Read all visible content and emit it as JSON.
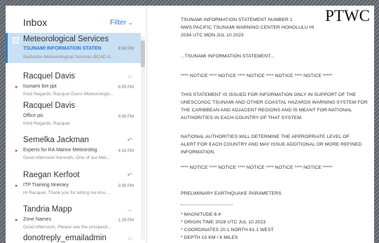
{
  "inbox": {
    "title": "Inbox",
    "filter_label": "Filter",
    "messages": [
      {
        "sender": "Meteorological Services",
        "subject": "TSUNAMI INFORMATION STATEN",
        "time": "6:58 PM",
        "preview": "Barbados Meteorological Services BCAD 8..."
      },
      {
        "sender": "Racquel Davis",
        "subject": "tsunami bot ppt",
        "time": "6:09 PM",
        "preview": "Kind Regards, Racquel Davis Meteorologis..."
      },
      {
        "sender": "Racquel Davis",
        "subject": "Office pic",
        "time": "6:06 PM",
        "preview": "Kind Regards, Racquel"
      },
      {
        "sender": "Semelka Jackman",
        "subject": "Experts for RA Marine Meteorolog",
        "time": "4:16 PM",
        "preview": "Good Afternoon Kenneth, One of our Met..."
      },
      {
        "sender": "Raegan Kerfoot",
        "subject": "ITP Training Itinerary",
        "time": "3:39 PM",
        "preview": "Hi Racquel, Thank you for letting me kno..."
      },
      {
        "sender": "Tandria Mapp",
        "subject": "Zone Names",
        "time": "1:26 PM",
        "preview": "Good Afternoon, Please see the prospecti..."
      },
      {
        "sender": "donotreply_emailadmin",
        "subject": "",
        "time": "",
        "preview": ""
      }
    ]
  },
  "reading": {
    "watermark": "PTWC",
    "lines": [
      "TSUNAMI INFORMATION STATEMENT NUMBER 1",
      "NWS PACIFIC TSUNAMI WARNING CENTER HONOLULU HI",
      "2034 UTC MON JUL 10 2023",
      "...TSUNAMI INFORMATION STATEMENT...",
      "**** NOTICE **** NOTICE **** NOTICE **** NOTICE **** NOTICE *****",
      "THIS STATEMENT IS ISSUED FOR INFORMATION ONLY IN SUPPORT OF THE",
      "UNESCO/IOC TSUNAMI AND OTHER COASTAL HAZARDS WARNING SYSTEM FOR",
      "THE CARIBBEAN AND ADJACENT REGIONS AND IS MEANT FOR NATIONAL",
      "AUTHORITIES IN EACH COUNTRY OF THAT SYSTEM.",
      "NATIONAL AUTHORITIES WILL DETERMINE THE APPROPRIATE LEVEL OF",
      "ALERT FOR EACH COUNTRY AND MAY ISSUE ADDITIONAL OR MORE REFINED",
      "INFORMATION.",
      "**** NOTICE **** NOTICE **** NOTICE **** NOTICE **** NOTICE *****",
      "PRELIMINARY EARTHQUAKE PARAMETERS",
      "* MAGNITUDE    6.4",
      "* ORIGIN TIME   2028 UTC JUL 10 2023",
      "* COORDINATES   20.1 NORTH  61.1 WEST",
      "* DEPTH        10 KM / 6 MILES"
    ]
  },
  "colors": {
    "accent": "#2b7cd3",
    "selected_bg": "#c9dff3"
  },
  "icons": [
    "filter-chevron-icon",
    "attachment-icon",
    "reply-icon",
    "forward-icon",
    "thread-expand-icon",
    "select-checkbox-icon"
  ]
}
